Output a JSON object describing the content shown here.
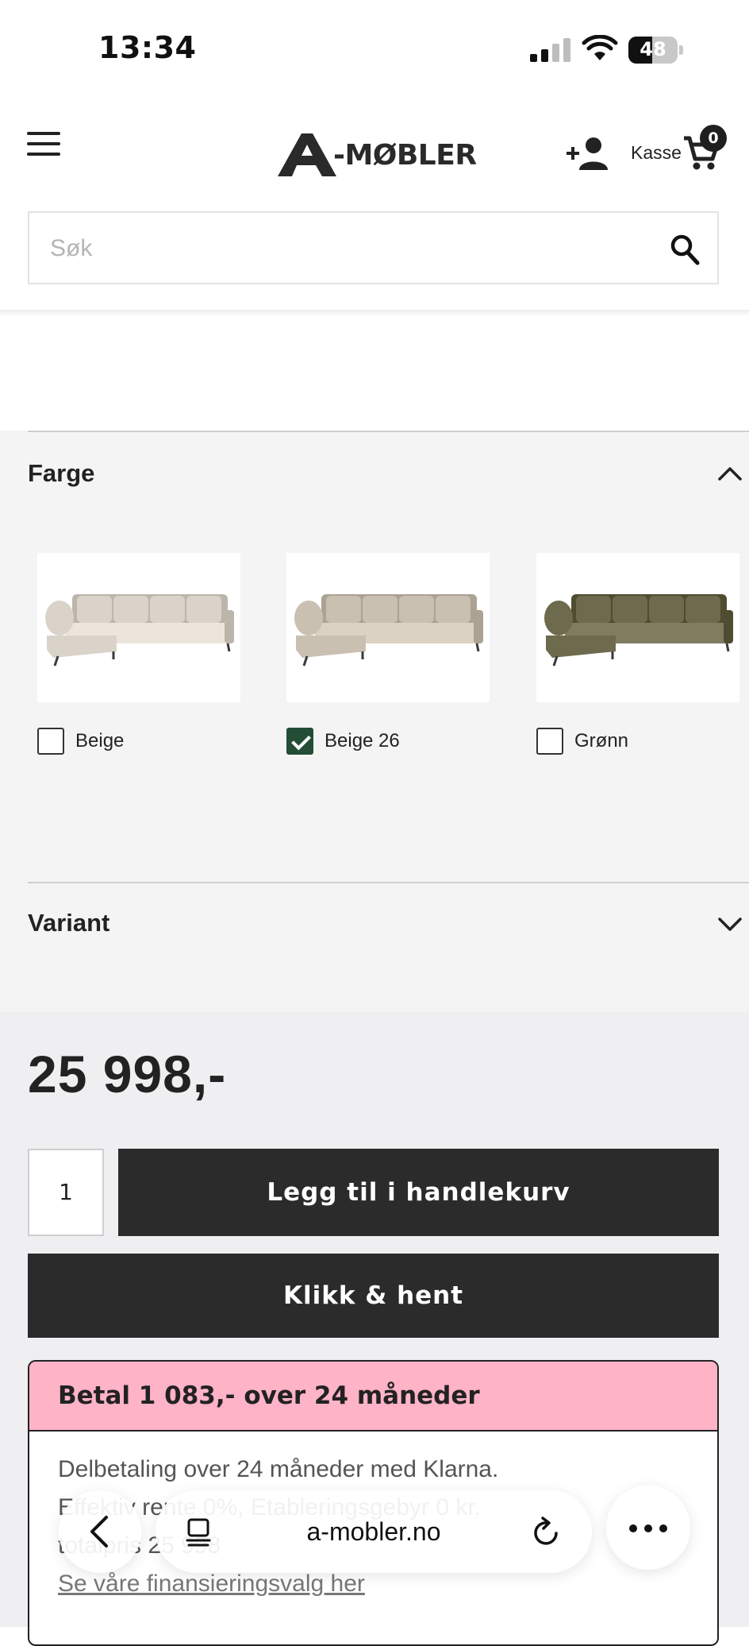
{
  "status_bar": {
    "time": "13:34",
    "battery": "48",
    "battery_level": 0.48
  },
  "header": {
    "logo_text": "-MØBLER",
    "checkout_label": "Kasse",
    "cart_count": "0"
  },
  "search": {
    "placeholder": "Søk"
  },
  "colour_filter": {
    "title": "Farge",
    "options": [
      {
        "label": "Beige",
        "checked": false,
        "sofa_color": "#d9d3ca"
      },
      {
        "label": "Beige 26",
        "checked": true,
        "sofa_color": "#c9c0b2"
      },
      {
        "label": "Grønn",
        "checked": false,
        "sofa_color": "#6d6a4e"
      }
    ]
  },
  "variant": {
    "title": "Variant"
  },
  "product": {
    "price": "25 998,-",
    "quantity": "1",
    "add_to_cart_label": "Legg til i handlekurv",
    "click_collect_label": "Klikk & hent"
  },
  "financing": {
    "heading": "Betal 1 083,- over 24 måneder",
    "line1": "Delbetaling over 24 måneder med Klarna.",
    "line2": "Effektiv rente 0%, Etableringsgebyr 0 kr.",
    "line3": "totalpris 25 998",
    "link": "Se våre finansieringsvalg her"
  },
  "browser": {
    "url": "a-mobler.no"
  },
  "colors": {
    "accent_pink": "#ffb3c7",
    "button_dark": "#2b2b2b",
    "checkbox_green": "#234d35"
  }
}
